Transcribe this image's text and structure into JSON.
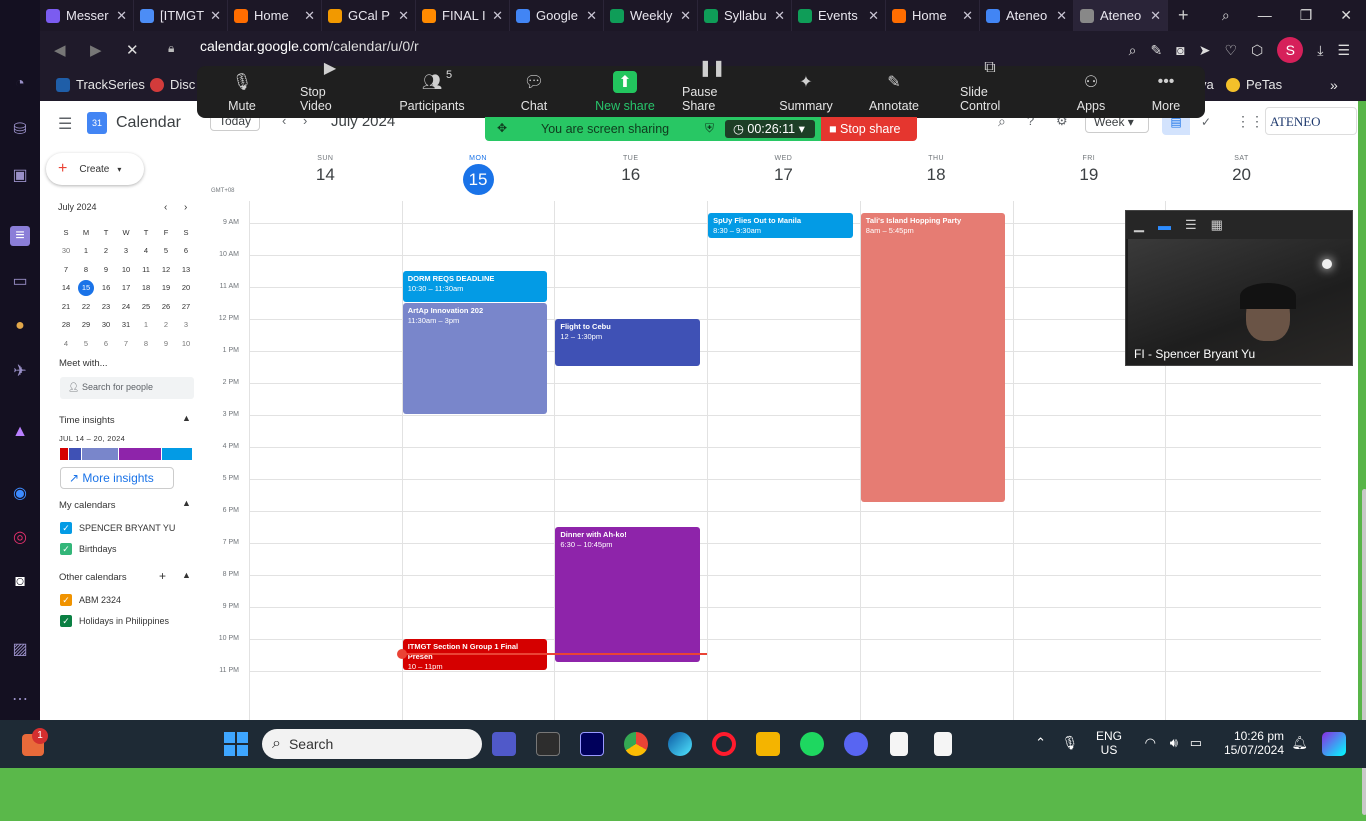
{
  "browser": {
    "tabs": [
      {
        "title": "Messer",
        "color": "#7b5cf0",
        "active": false
      },
      {
        "title": "[ITMGT",
        "color": "#4c8df6",
        "active": false
      },
      {
        "title": "Home",
        "color": "#ff6d00",
        "active": false
      },
      {
        "title": "GCal P",
        "color": "#f29900",
        "active": false
      },
      {
        "title": "FINAL I",
        "color": "#ff8a00",
        "active": false
      },
      {
        "title": "Google",
        "color": "#4285f4",
        "active": false
      },
      {
        "title": "Weekly",
        "color": "#0f9d58",
        "active": false
      },
      {
        "title": "Syllabu",
        "color": "#0f9d58",
        "active": false
      },
      {
        "title": "Events",
        "color": "#0f9d58",
        "active": false
      },
      {
        "title": "Home",
        "color": "#ff6d00",
        "active": false
      },
      {
        "title": "Ateneo",
        "color": "#4285f4",
        "active": false
      },
      {
        "title": "Ateneo",
        "color": "#888888",
        "active": true
      }
    ],
    "url_host": "calendar.google.com",
    "url_path": "/calendar/u/0/r",
    "profile_initial": "S",
    "bookmarks": [
      "TrackSeries",
      "Disc",
      "va",
      "PeTas"
    ]
  },
  "zoom": {
    "controls": [
      {
        "label": "Mute",
        "icon": "microphone-icon"
      },
      {
        "label": "Stop Video",
        "icon": "camera-icon"
      },
      {
        "label": "Participants",
        "icon": "participants-icon",
        "count": "5"
      },
      {
        "label": "Chat",
        "icon": "chat-icon"
      },
      {
        "label": "New share",
        "icon": "share-arrow-icon"
      },
      {
        "label": "Pause Share",
        "icon": "pause-icon"
      },
      {
        "label": "Summary",
        "icon": "summary-icon"
      },
      {
        "label": "Annotate",
        "icon": "pen-icon"
      },
      {
        "label": "Slide Control",
        "icon": "slide-icon"
      },
      {
        "label": "Apps",
        "icon": "apps-icon"
      },
      {
        "label": "More",
        "icon": "more-icon"
      }
    ],
    "sharing_text": "You are screen sharing",
    "timer": "00:26:11",
    "stop_share": "Stop share",
    "video_name": "FI - Spencer Bryant Yu"
  },
  "calendar": {
    "app_name": "Calendar",
    "today_btn": "Today",
    "month_label": "July 2024",
    "view": "Week",
    "org": "ATENEO",
    "create": "Create",
    "mini_month": "July 2024",
    "mini_days": [
      "S",
      "M",
      "T",
      "W",
      "T",
      "F",
      "S"
    ],
    "mini_weeks": [
      [
        "30",
        "1",
        "2",
        "3",
        "4",
        "5",
        "6"
      ],
      [
        "7",
        "8",
        "9",
        "10",
        "11",
        "12",
        "13"
      ],
      [
        "14",
        "15",
        "16",
        "17",
        "18",
        "19",
        "20"
      ],
      [
        "21",
        "22",
        "23",
        "24",
        "25",
        "26",
        "27"
      ],
      [
        "28",
        "29",
        "30",
        "31",
        "1",
        "2",
        "3"
      ],
      [
        "4",
        "5",
        "6",
        "7",
        "8",
        "9",
        "10"
      ]
    ],
    "meet_with": "Meet with...",
    "search_people": "Search for people",
    "time_insights": "Time insights",
    "insights_range": "JUL 14 – 20, 2024",
    "more_insights": "More insights",
    "my_calendars": "My calendars",
    "my_cal_items": [
      {
        "name": "SPENCER BRYANT YU",
        "color": "#039be5"
      },
      {
        "name": "Birthdays",
        "color": "#33b679"
      }
    ],
    "other_calendars": "Other calendars",
    "other_cal_items": [
      {
        "name": "ABM 2324",
        "color": "#f09300"
      },
      {
        "name": "Holidays in Philippines",
        "color": "#0b8043"
      }
    ],
    "timezone": "GMT+08",
    "days": [
      {
        "name": "SUN",
        "num": "14"
      },
      {
        "name": "MON",
        "num": "15"
      },
      {
        "name": "TUE",
        "num": "16"
      },
      {
        "name": "WED",
        "num": "17"
      },
      {
        "name": "THU",
        "num": "18"
      },
      {
        "name": "FRI",
        "num": "19"
      },
      {
        "name": "SAT",
        "num": "20"
      }
    ],
    "hours": [
      "9 AM",
      "10 AM",
      "11 AM",
      "12 PM",
      "1 PM",
      "2 PM",
      "3 PM",
      "4 PM",
      "5 PM",
      "6 PM",
      "7 PM",
      "8 PM",
      "9 PM",
      "10 PM",
      "11 PM"
    ],
    "events": [
      {
        "title": "SpUy Flies Out to Manila",
        "time": "8:30 – 9:30am",
        "day": 3,
        "start": 8.5,
        "end": 9.5,
        "color": "#039be5"
      },
      {
        "title": "Tali's Island Hopping Party",
        "time": "8am – 5:45pm",
        "day": 4,
        "start": 8.0,
        "end": 17.75,
        "color": "#e67c73"
      },
      {
        "title": "DORM REQS DEADLINE",
        "time": "10:30 – 11:30am",
        "day": 1,
        "start": 10.5,
        "end": 11.5,
        "color": "#039be5"
      },
      {
        "title": "ArtAp Innovation 202",
        "time": "11:30am – 3pm",
        "day": 1,
        "start": 11.5,
        "end": 15.0,
        "color": "#7986cb"
      },
      {
        "title": "Flight to Cebu",
        "time": "12 – 1:30pm",
        "day": 2,
        "start": 12.0,
        "end": 13.5,
        "color": "#3f51b5"
      },
      {
        "title": "Dinner with Ah-ko!",
        "time": "6:30 – 10:45pm",
        "day": 2,
        "start": 18.5,
        "end": 22.75,
        "color": "#8e24aa"
      },
      {
        "title": "ITMGT Section N Group 1 Final Presen",
        "time": "10 – 11pm",
        "day": 1,
        "start": 22.0,
        "end": 23.0,
        "color": "#d50000"
      }
    ]
  },
  "taskbar": {
    "search": "Search",
    "lang": "ENG",
    "region": "US",
    "time": "10:26 pm",
    "date": "15/07/2024",
    "badge": "1"
  }
}
